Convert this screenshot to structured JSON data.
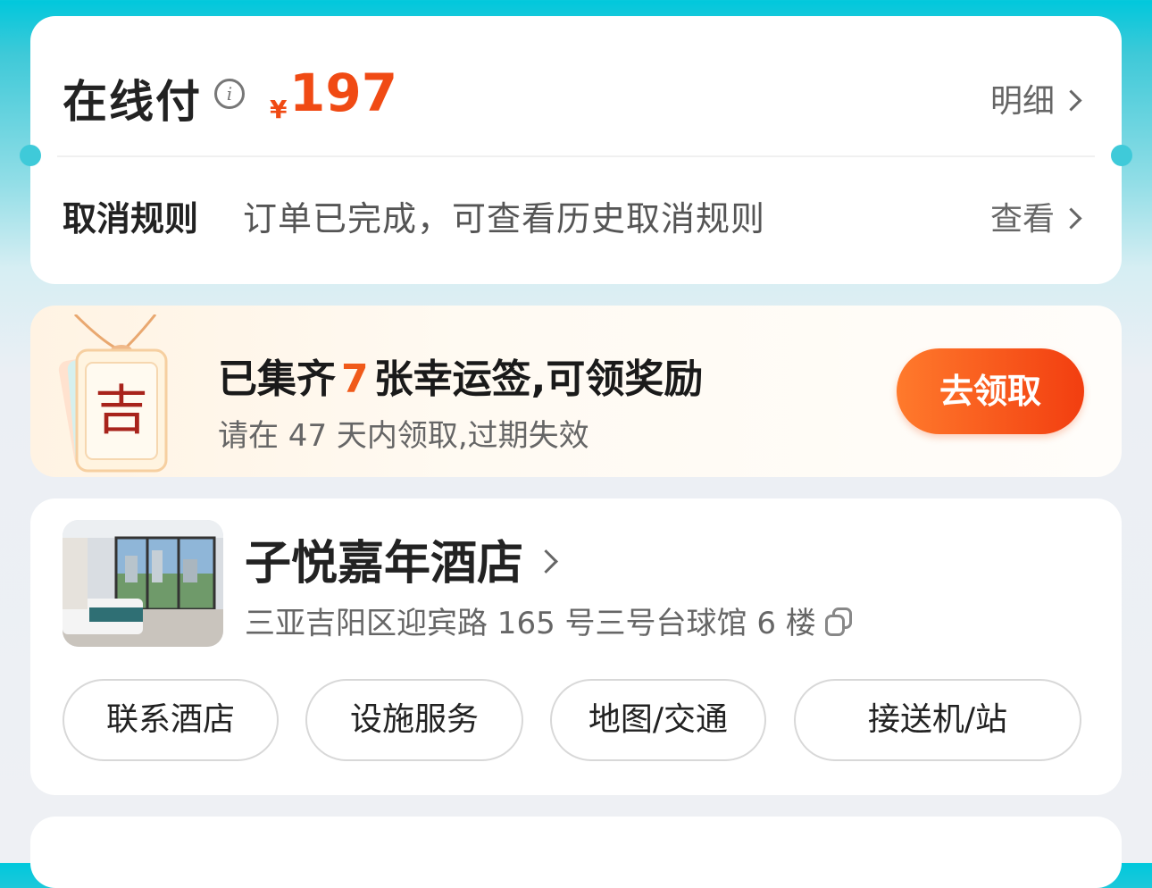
{
  "payment": {
    "title": "在线付",
    "currency": "¥",
    "amount": "197",
    "detail_link": "明细",
    "cancel_label": "取消规则",
    "cancel_text": "订单已完成，可查看历史取消规则",
    "view_link": "查看"
  },
  "lucky": {
    "tag_char": "吉",
    "title_prefix": "已集齐",
    "count": "7",
    "title_suffix": "张幸运签,可领奖励",
    "subtitle": "请在 47 天内领取,过期失效",
    "button": "去领取"
  },
  "hotel": {
    "name": "子悦嘉年酒店",
    "address": "三亚吉阳区迎宾路 165 号三号台球馆 6 楼",
    "actions": [
      "联系酒店",
      "设施服务",
      "地图/交通",
      "接送机/站"
    ]
  },
  "colors": {
    "accent": "#f04a14",
    "header_bg": "#00c8dc",
    "page_bg": "#eef0f4"
  }
}
